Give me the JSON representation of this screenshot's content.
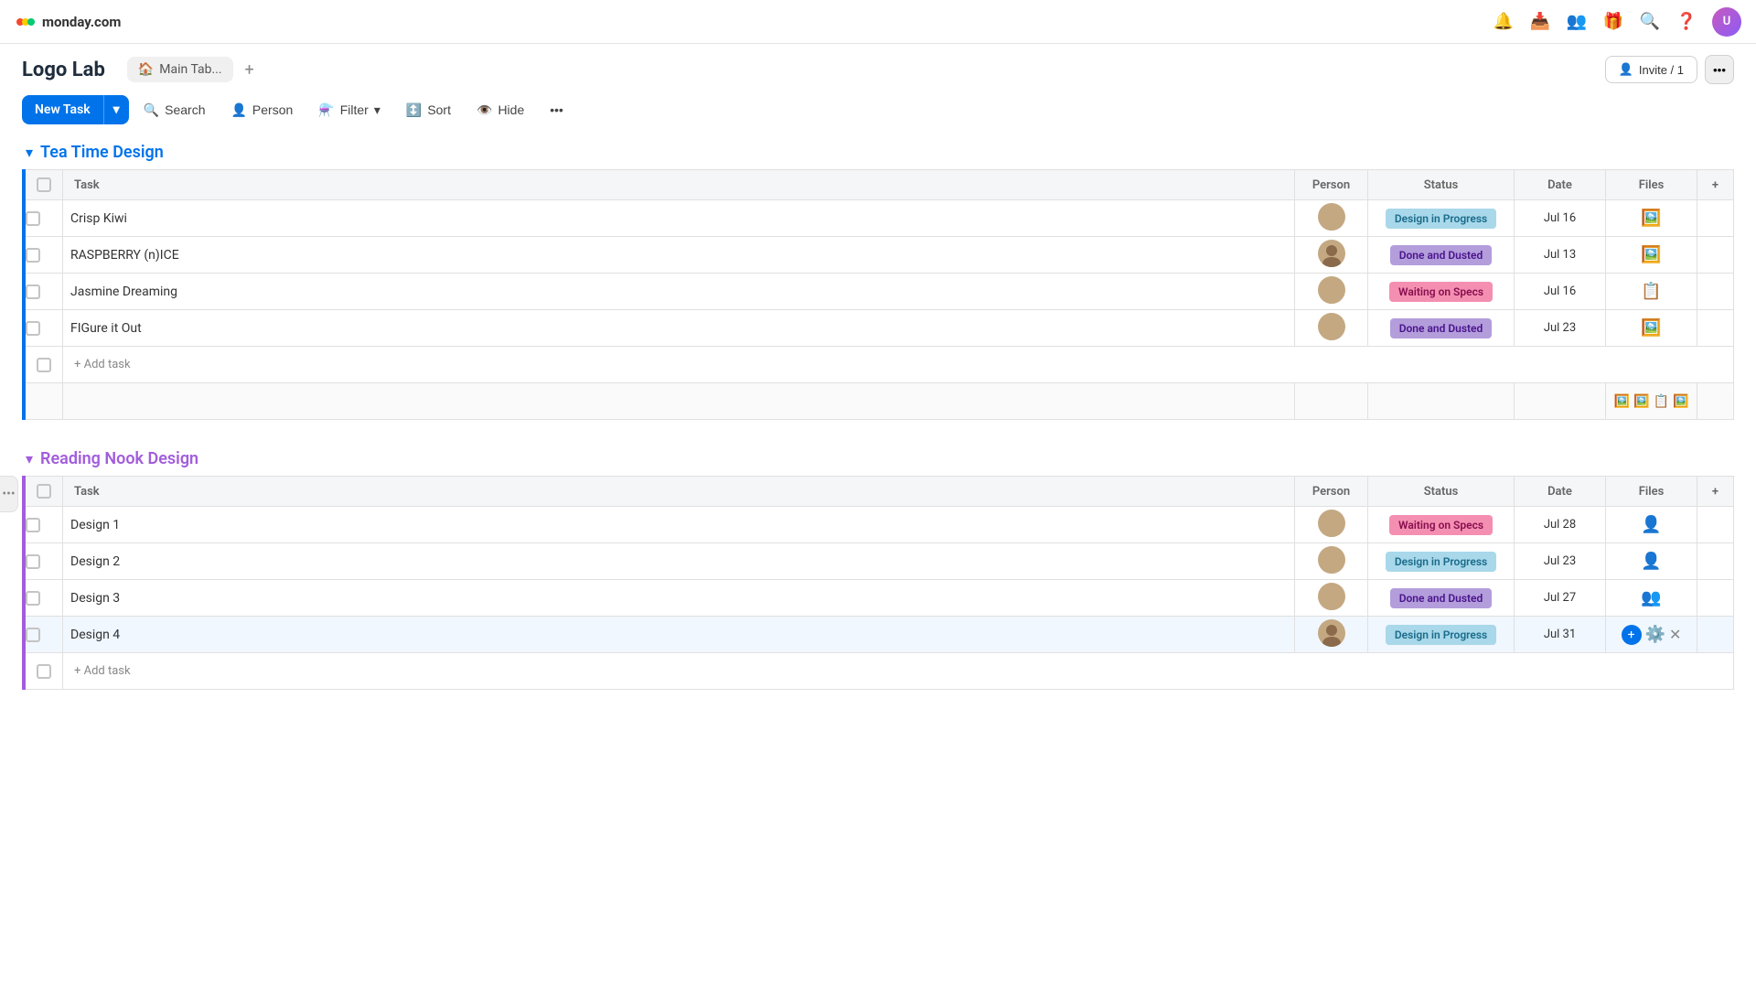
{
  "brand": {
    "name": "monday.com"
  },
  "board": {
    "title": "Logo Lab",
    "tab_label": "Main Tab...",
    "invite_label": "Invite / 1"
  },
  "toolbar": {
    "new_task_label": "New Task",
    "search_label": "Search",
    "person_label": "Person",
    "filter_label": "Filter",
    "sort_label": "Sort",
    "hide_label": "Hide"
  },
  "groups": [
    {
      "id": "tea-time",
      "title": "Tea Time Design",
      "color": "blue",
      "columns": [
        "Task",
        "Person",
        "Status",
        "Date",
        "Files"
      ],
      "tasks": [
        {
          "name": "Crisp Kiwi",
          "status": "Design in Progress",
          "status_type": "design-progress",
          "date": "Jul 16"
        },
        {
          "name": "RASPBERRY (n)ICE",
          "status": "Done and Dusted",
          "status_type": "done",
          "date": "Jul 13"
        },
        {
          "name": "Jasmine Dreaming",
          "status": "Waiting on Specs",
          "status_type": "waiting",
          "date": "Jul 16"
        },
        {
          "name": "FIGure it Out",
          "status": "Done and Dusted",
          "status_type": "done",
          "date": "Jul 23"
        }
      ],
      "add_task_label": "+ Add task"
    },
    {
      "id": "reading-nook",
      "title": "Reading Nook Design",
      "color": "purple",
      "columns": [
        "Task",
        "Person",
        "Status",
        "Date",
        "Files"
      ],
      "tasks": [
        {
          "name": "Design 1",
          "status": "Waiting on Specs",
          "status_type": "waiting",
          "date": "Jul 28"
        },
        {
          "name": "Design 2",
          "status": "Design in Progress",
          "status_type": "design-progress",
          "date": "Jul 23"
        },
        {
          "name": "Design 3",
          "status": "Done and Dusted",
          "status_type": "done",
          "date": "Jul 27"
        },
        {
          "name": "Design 4",
          "status": "Design in Progress",
          "status_type": "design-progress",
          "date": "Jul 31",
          "highlighted": true
        }
      ],
      "add_task_label": "+ Add task"
    }
  ]
}
